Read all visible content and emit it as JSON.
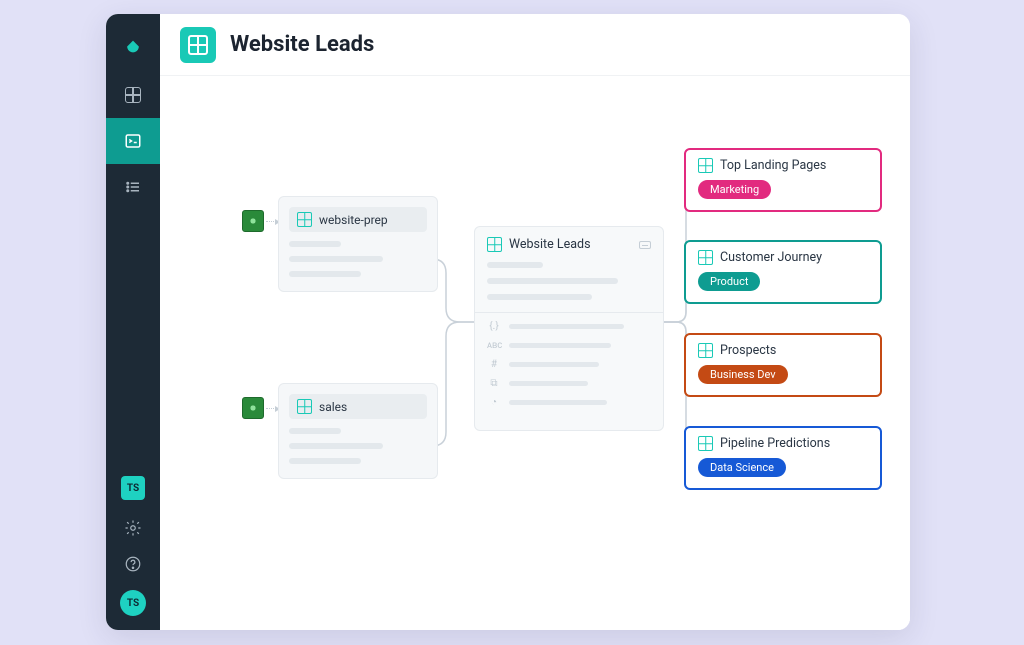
{
  "sidebar": {
    "badge": "TS",
    "avatar": "TS"
  },
  "header": {
    "title": "Website Leads"
  },
  "sources": [
    {
      "label": "website-prep"
    },
    {
      "label": "sales"
    }
  ],
  "center": {
    "title": "Website Leads"
  },
  "outputs": [
    {
      "title": "Top Landing Pages",
      "tag": "Marketing",
      "border": "#e22a7f",
      "tagbg": "#e22a7f"
    },
    {
      "title": "Customer Journey",
      "tag": "Product",
      "border": "#0e9c91",
      "tagbg": "#0e9c91"
    },
    {
      "title": "Prospects",
      "tag": "Business Dev",
      "border": "#c44a14",
      "tagbg": "#c44a14"
    },
    {
      "title": "Pipeline Predictions",
      "tag": "Data Science",
      "border": "#1659d6",
      "tagbg": "#1659d6"
    }
  ]
}
